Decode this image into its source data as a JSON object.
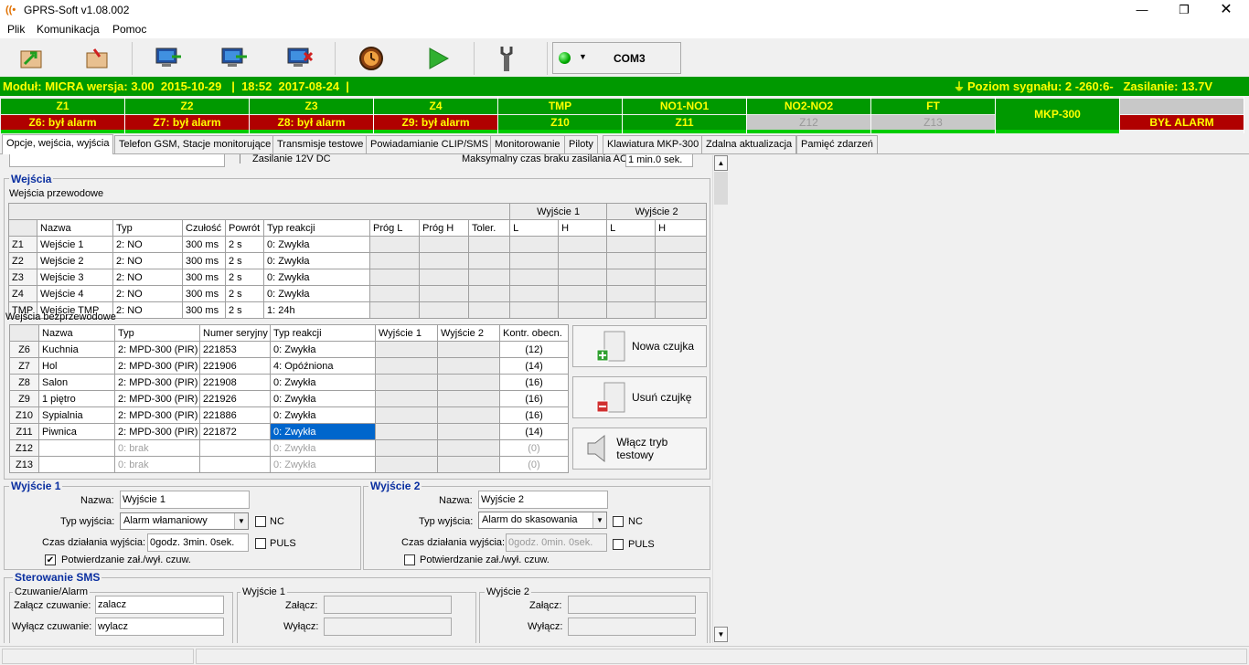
{
  "app": {
    "title": "GPRS-Soft v1.08.002"
  },
  "menu": [
    "Plik",
    "Komunikacja",
    "Pomoc"
  ],
  "toolbar": {
    "com_port": "COM3"
  },
  "status": {
    "module": "Moduł: MICRA wersja: 3.00  2015-10-29   |  18:52  2017-08-24  |",
    "signal": "Poziom sygnału: 2 -260:6-   Zasilanie: 13.7V"
  },
  "zones": [
    {
      "top": "Z1",
      "bottom": "Z6: był alarm",
      "state": "alarm"
    },
    {
      "top": "Z2",
      "bottom": "Z7: był alarm",
      "state": "alarm"
    },
    {
      "top": "Z3",
      "bottom": "Z8: był alarm",
      "state": "alarm"
    },
    {
      "top": "Z4",
      "bottom": "Z9: był alarm",
      "state": "alarm"
    },
    {
      "top": "TMP",
      "bottom": "Z10",
      "state": "ok"
    },
    {
      "top": "NO1-NO1",
      "bottom": "Z11",
      "state": "ok"
    },
    {
      "top": "NO2-NO2",
      "bottom": "Z12",
      "state": "gray"
    },
    {
      "top": "FT",
      "bottom": "Z13",
      "state": "gray"
    },
    {
      "top": "MKP-300",
      "bottom": "",
      "state": "single"
    },
    {
      "top": "",
      "bottom": "BYŁ ALARM",
      "state": "alarmbox"
    }
  ],
  "tabs": [
    "Opcje, wejścia, wyjścia",
    "Telefon GSM, Stacje monitorujące",
    "Transmisje testowe",
    "Powiadamianie CLIP/SMS",
    "Monitorowanie",
    "Piloty",
    "Klawiatura MKP-300",
    "Zdalna aktualizacja",
    "Pamięć zdarzeń"
  ],
  "top_partial": {
    "left": "Zasilanie 12V DC",
    "right_label": "Maksymalny czas braku zasilania AC:",
    "right_value": "1 min.0 sek."
  },
  "wejscia": {
    "title": "Wejścia",
    "wired": {
      "caption": "Wejścia przewodowe",
      "out1": "Wyjście 1",
      "out2": "Wyjście 2",
      "headers": [
        "",
        "Nazwa",
        "Typ",
        "Czułość",
        "Powrót",
        "Typ reakcji",
        "Próg L",
        "Próg H",
        "Toler.",
        "L",
        "H",
        "L",
        "H"
      ],
      "rows": [
        [
          "Z1",
          "Wejście 1",
          "2: NO",
          "300 ms",
          "2 s",
          "0: Zwykła"
        ],
        [
          "Z2",
          "Wejście 2",
          "2: NO",
          "300 ms",
          "2 s",
          "0: Zwykła"
        ],
        [
          "Z3",
          "Wejście 3",
          "2: NO",
          "300 ms",
          "2 s",
          "0: Zwykła"
        ],
        [
          "Z4",
          "Wejście 4",
          "2: NO",
          "300 ms",
          "2 s",
          "0: Zwykła"
        ],
        [
          "TMP",
          "Wejście TMP",
          "2: NO",
          "300 ms",
          "2 s",
          "1: 24h"
        ]
      ]
    },
    "wireless": {
      "caption": "Wejścia bezprzewodowe",
      "headers": [
        "",
        "Nazwa",
        "Typ",
        "Numer seryjny",
        "Typ reakcji",
        "Wyjście 1",
        "Wyjście 2",
        "Kontr. obecn."
      ],
      "rows": [
        [
          "Z6",
          "Kuchnia",
          "2: MPD-300 (PIR)",
          "221853",
          "0: Zwykła",
          "(12)"
        ],
        [
          "Z7",
          "Hol",
          "2: MPD-300 (PIR)",
          "221906",
          "4: Opóźniona",
          "(14)"
        ],
        [
          "Z8",
          "Salon",
          "2: MPD-300 (PIR)",
          "221908",
          "0: Zwykła",
          "(16)"
        ],
        [
          "Z9",
          "1 piętro",
          "2: MPD-300 (PIR)",
          "221926",
          "0: Zwykła",
          "(16)"
        ],
        [
          "Z10",
          "Sypialnia",
          "2: MPD-300 (PIR)",
          "221886",
          "0: Zwykła",
          "(16)"
        ],
        [
          "Z11",
          "Piwnica",
          "2: MPD-300 (PIR)",
          "221872",
          "0: Zwykła",
          "(14)"
        ],
        [
          "Z12",
          "",
          "0: brak",
          "",
          "0: Zwykła",
          "(0)"
        ],
        [
          "Z13",
          "",
          "0: brak",
          "",
          "0: Zwykła",
          "(0)"
        ]
      ],
      "btn_new": "Nowa czujka",
      "btn_del": "Usuń czujkę",
      "btn_test": "Włącz tryb testowy"
    }
  },
  "out1": {
    "title": "Wyjście 1",
    "name_label": "Nazwa:",
    "name": "Wyjście 1",
    "type_label": "Typ wyjścia:",
    "type": "Alarm włamaniowy",
    "nc": "NC",
    "time_label": "Czas działania wyjścia:",
    "time": "0godz. 3min. 0sek.",
    "puls": "PULS",
    "confirm": "Potwierdzanie zał./wył. czuw."
  },
  "out2": {
    "title": "Wyjście 2",
    "name_label": "Nazwa:",
    "name": "Wyjście 2",
    "type_label": "Typ wyjścia:",
    "type": "Alarm do skasowania",
    "nc": "NC",
    "time_label": "Czas działania wyjścia:",
    "time": "0godz. 0min. 0sek.",
    "puls": "PULS",
    "confirm": "Potwierdzanie zał./wył. czuw."
  },
  "sms": {
    "title": "Sterowanie SMS",
    "g1": "Czuwanie/Alarm",
    "on_label": "Załącz czuwanie:",
    "on": "zalacz",
    "off_label": "Wyłącz czuwanie:",
    "off": "wylacz",
    "g2": "Wyjście 1",
    "g3": "Wyjście 2",
    "zal": "Załącz:",
    "wyl": "Wyłącz:"
  },
  "colors": {
    "status_bg": "#009900",
    "status_fg": "#ffff00",
    "alarm_bg": "#b00000",
    "title_blue": "#0a2fa0"
  }
}
